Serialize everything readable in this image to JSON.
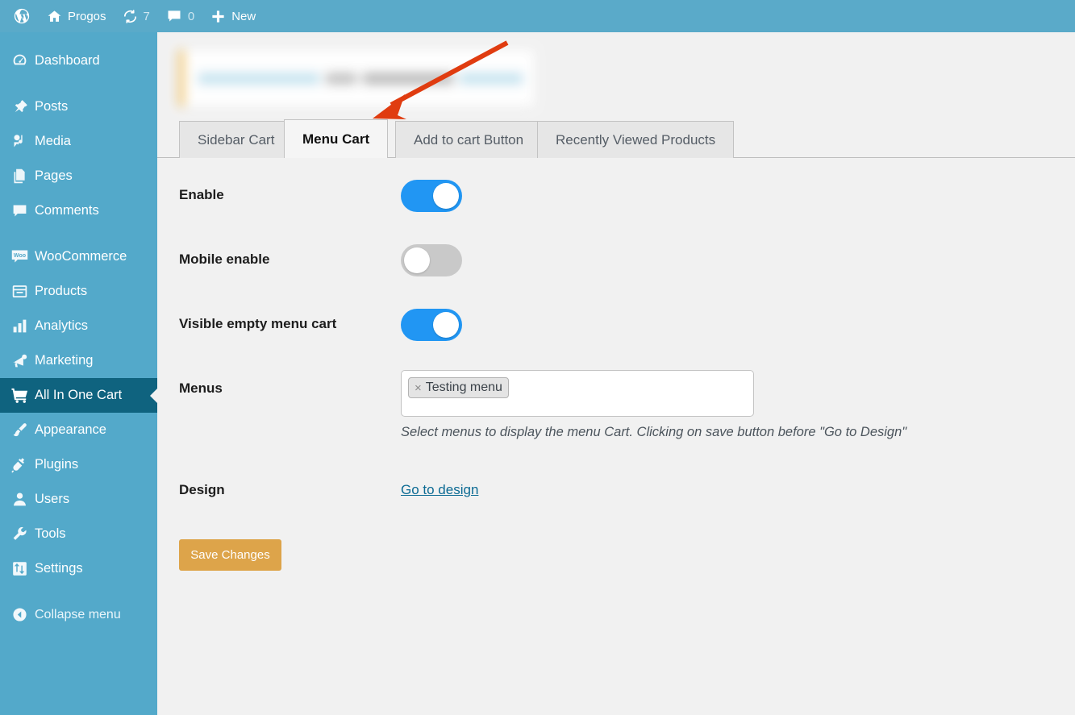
{
  "adminbar": {
    "logo_icon": "wordpress-logo-icon",
    "site_icon": "home-icon",
    "site_name": "Progos",
    "updates_icon": "updates-icon",
    "updates_count": "7",
    "comments_icon": "comment-bubble-icon",
    "comments_count": "0",
    "new_icon": "plus-icon",
    "new_label": "New"
  },
  "sidebar": {
    "items": [
      {
        "label": "Dashboard",
        "icon": "dashboard-icon",
        "current": false
      },
      {
        "label": "Posts",
        "icon": "pin-icon",
        "current": false
      },
      {
        "label": "Media",
        "icon": "media-icon",
        "current": false
      },
      {
        "label": "Pages",
        "icon": "pages-icon",
        "current": false
      },
      {
        "label": "Comments",
        "icon": "comment-icon",
        "current": false
      },
      {
        "label": "WooCommerce",
        "icon": "woocommerce-icon",
        "current": false
      },
      {
        "label": "Products",
        "icon": "products-icon",
        "current": false
      },
      {
        "label": "Analytics",
        "icon": "analytics-icon",
        "current": false
      },
      {
        "label": "Marketing",
        "icon": "megaphone-icon",
        "current": false
      },
      {
        "label": "All In One Cart",
        "icon": "cart-icon",
        "current": true
      },
      {
        "label": "Appearance",
        "icon": "paintbrush-icon",
        "current": false
      },
      {
        "label": "Plugins",
        "icon": "plug-icon",
        "current": false
      },
      {
        "label": "Users",
        "icon": "user-icon",
        "current": false
      },
      {
        "label": "Tools",
        "icon": "wrench-icon",
        "current": false
      },
      {
        "label": "Settings",
        "icon": "settings-icon",
        "current": false
      }
    ],
    "collapse": {
      "label": "Collapse menu",
      "icon": "collapse-arrow-icon"
    }
  },
  "tabs": [
    {
      "label": "Sidebar Cart",
      "active": false
    },
    {
      "label": "Menu Cart",
      "active": true
    },
    {
      "label": "Add to cart Button",
      "active": false
    },
    {
      "label": "Recently Viewed Products",
      "active": false
    }
  ],
  "form": {
    "enable": {
      "label": "Enable",
      "state": "on"
    },
    "mobile_enable": {
      "label": "Mobile enable",
      "state": "off"
    },
    "visible_empty_menu_cart": {
      "label": "Visible empty menu cart",
      "state": "on"
    },
    "menus": {
      "label": "Menus",
      "chips": [
        {
          "text": "Testing menu",
          "remove_icon": "×"
        }
      ],
      "help": "Select menus to display the menu Cart. Clicking on save button before \"Go to Design\""
    },
    "design": {
      "label": "Design",
      "link_label": "Go to design"
    },
    "save_label": "Save Changes"
  },
  "annotation": {
    "type": "arrow",
    "color": "#e03c10",
    "points_to": "Menu Cart tab"
  },
  "colors": {
    "sidebar": "#53a9ca",
    "sidebar_active": "#0f637f",
    "adminbar": "#5aaac9",
    "toggle_on": "#2196f3",
    "toggle_off": "#c9c9c9",
    "save_button": "#dda44a",
    "link": "#0b6a93",
    "content_bg": "#f1f1f1",
    "notice_accent": "#f0b849"
  }
}
